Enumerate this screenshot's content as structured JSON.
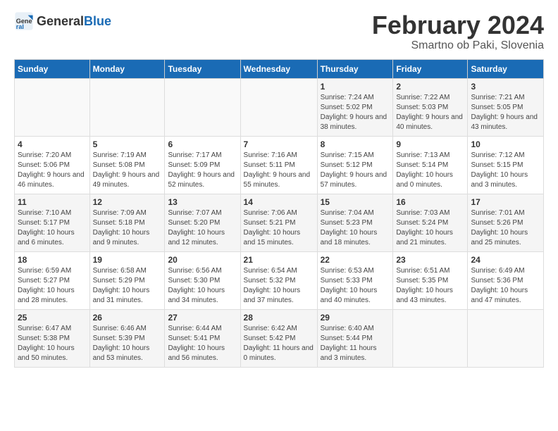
{
  "header": {
    "logo_general": "General",
    "logo_blue": "Blue",
    "month_title": "February 2024",
    "subtitle": "Smartno ob Paki, Slovenia"
  },
  "days_of_week": [
    "Sunday",
    "Monday",
    "Tuesday",
    "Wednesday",
    "Thursday",
    "Friday",
    "Saturday"
  ],
  "weeks": [
    [
      {
        "day": "",
        "info": ""
      },
      {
        "day": "",
        "info": ""
      },
      {
        "day": "",
        "info": ""
      },
      {
        "day": "",
        "info": ""
      },
      {
        "day": "1",
        "info": "Sunrise: 7:24 AM\nSunset: 5:02 PM\nDaylight: 9 hours\nand 38 minutes."
      },
      {
        "day": "2",
        "info": "Sunrise: 7:22 AM\nSunset: 5:03 PM\nDaylight: 9 hours\nand 40 minutes."
      },
      {
        "day": "3",
        "info": "Sunrise: 7:21 AM\nSunset: 5:05 PM\nDaylight: 9 hours\nand 43 minutes."
      }
    ],
    [
      {
        "day": "4",
        "info": "Sunrise: 7:20 AM\nSunset: 5:06 PM\nDaylight: 9 hours\nand 46 minutes."
      },
      {
        "day": "5",
        "info": "Sunrise: 7:19 AM\nSunset: 5:08 PM\nDaylight: 9 hours\nand 49 minutes."
      },
      {
        "day": "6",
        "info": "Sunrise: 7:17 AM\nSunset: 5:09 PM\nDaylight: 9 hours\nand 52 minutes."
      },
      {
        "day": "7",
        "info": "Sunrise: 7:16 AM\nSunset: 5:11 PM\nDaylight: 9 hours\nand 55 minutes."
      },
      {
        "day": "8",
        "info": "Sunrise: 7:15 AM\nSunset: 5:12 PM\nDaylight: 9 hours\nand 57 minutes."
      },
      {
        "day": "9",
        "info": "Sunrise: 7:13 AM\nSunset: 5:14 PM\nDaylight: 10 hours\nand 0 minutes."
      },
      {
        "day": "10",
        "info": "Sunrise: 7:12 AM\nSunset: 5:15 PM\nDaylight: 10 hours\nand 3 minutes."
      }
    ],
    [
      {
        "day": "11",
        "info": "Sunrise: 7:10 AM\nSunset: 5:17 PM\nDaylight: 10 hours\nand 6 minutes."
      },
      {
        "day": "12",
        "info": "Sunrise: 7:09 AM\nSunset: 5:18 PM\nDaylight: 10 hours\nand 9 minutes."
      },
      {
        "day": "13",
        "info": "Sunrise: 7:07 AM\nSunset: 5:20 PM\nDaylight: 10 hours\nand 12 minutes."
      },
      {
        "day": "14",
        "info": "Sunrise: 7:06 AM\nSunset: 5:21 PM\nDaylight: 10 hours\nand 15 minutes."
      },
      {
        "day": "15",
        "info": "Sunrise: 7:04 AM\nSunset: 5:23 PM\nDaylight: 10 hours\nand 18 minutes."
      },
      {
        "day": "16",
        "info": "Sunrise: 7:03 AM\nSunset: 5:24 PM\nDaylight: 10 hours\nand 21 minutes."
      },
      {
        "day": "17",
        "info": "Sunrise: 7:01 AM\nSunset: 5:26 PM\nDaylight: 10 hours\nand 25 minutes."
      }
    ],
    [
      {
        "day": "18",
        "info": "Sunrise: 6:59 AM\nSunset: 5:27 PM\nDaylight: 10 hours\nand 28 minutes."
      },
      {
        "day": "19",
        "info": "Sunrise: 6:58 AM\nSunset: 5:29 PM\nDaylight: 10 hours\nand 31 minutes."
      },
      {
        "day": "20",
        "info": "Sunrise: 6:56 AM\nSunset: 5:30 PM\nDaylight: 10 hours\nand 34 minutes."
      },
      {
        "day": "21",
        "info": "Sunrise: 6:54 AM\nSunset: 5:32 PM\nDaylight: 10 hours\nand 37 minutes."
      },
      {
        "day": "22",
        "info": "Sunrise: 6:53 AM\nSunset: 5:33 PM\nDaylight: 10 hours\nand 40 minutes."
      },
      {
        "day": "23",
        "info": "Sunrise: 6:51 AM\nSunset: 5:35 PM\nDaylight: 10 hours\nand 43 minutes."
      },
      {
        "day": "24",
        "info": "Sunrise: 6:49 AM\nSunset: 5:36 PM\nDaylight: 10 hours\nand 47 minutes."
      }
    ],
    [
      {
        "day": "25",
        "info": "Sunrise: 6:47 AM\nSunset: 5:38 PM\nDaylight: 10 hours\nand 50 minutes."
      },
      {
        "day": "26",
        "info": "Sunrise: 6:46 AM\nSunset: 5:39 PM\nDaylight: 10 hours\nand 53 minutes."
      },
      {
        "day": "27",
        "info": "Sunrise: 6:44 AM\nSunset: 5:41 PM\nDaylight: 10 hours\nand 56 minutes."
      },
      {
        "day": "28",
        "info": "Sunrise: 6:42 AM\nSunset: 5:42 PM\nDaylight: 11 hours\nand 0 minutes."
      },
      {
        "day": "29",
        "info": "Sunrise: 6:40 AM\nSunset: 5:44 PM\nDaylight: 11 hours\nand 3 minutes."
      },
      {
        "day": "",
        "info": ""
      },
      {
        "day": "",
        "info": ""
      }
    ]
  ]
}
